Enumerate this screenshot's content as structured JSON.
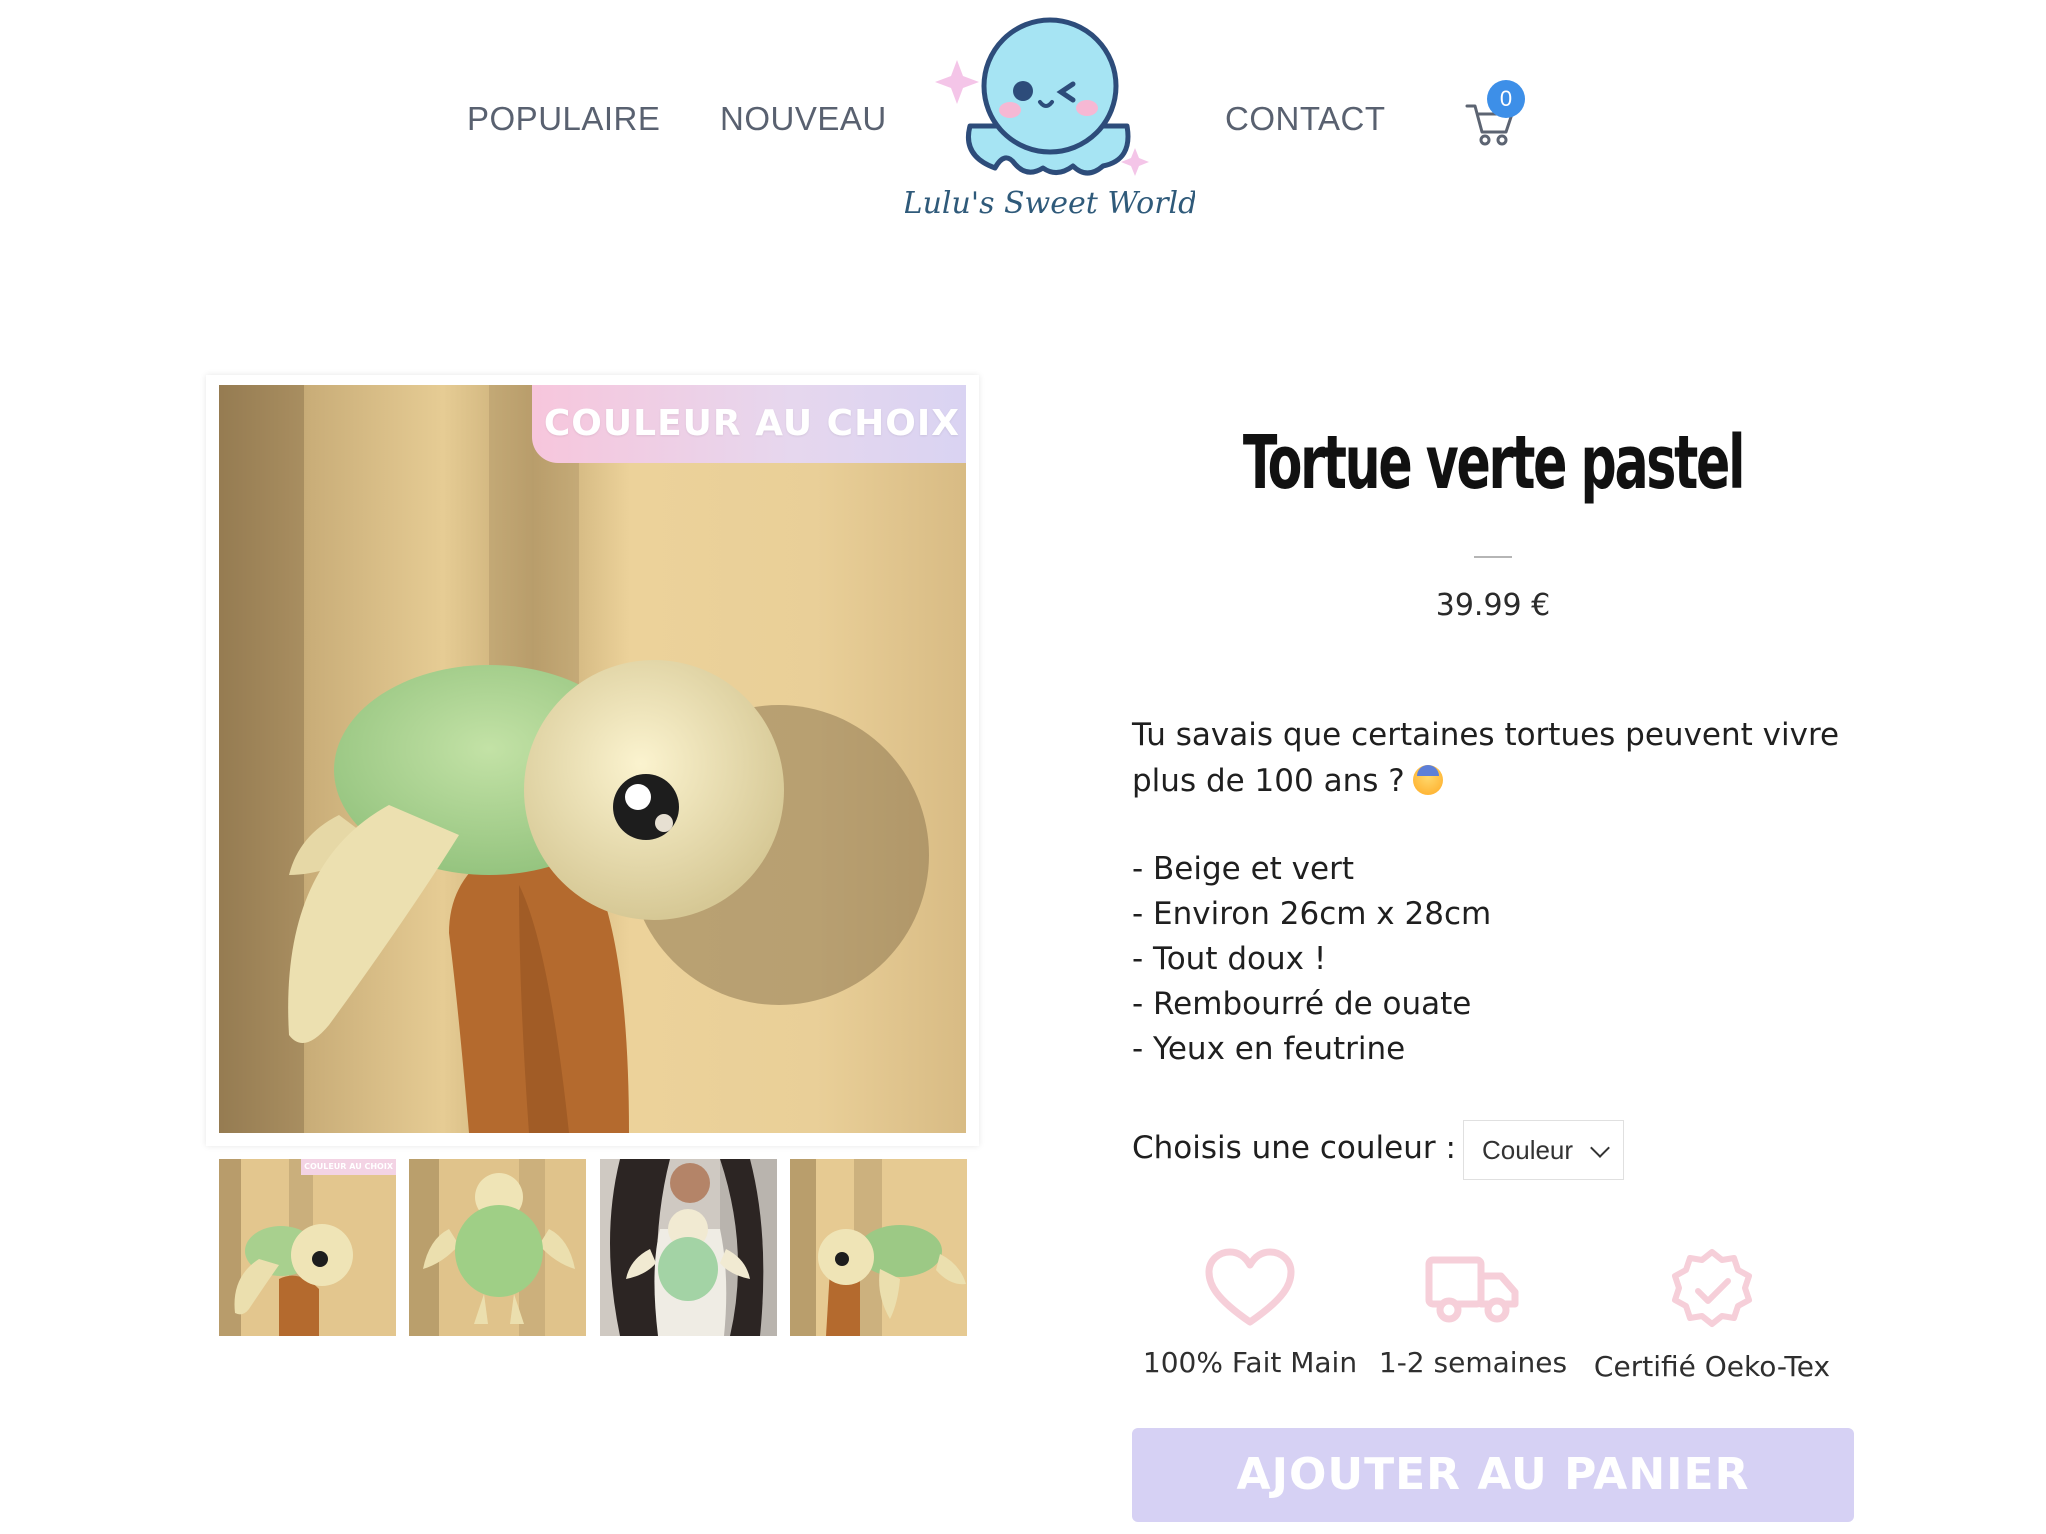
{
  "header": {
    "nav": [
      "POPULAIRE",
      "NOUVEAU",
      "CONTACT"
    ],
    "logo_text": "Lulu's Sweet World",
    "cart_count": "0",
    "icons": {
      "logo": "octopus-logo",
      "cart": "cart-icon"
    }
  },
  "gallery": {
    "main_badge": "COULEUR AU CHOIX",
    "thumbnails": 4
  },
  "product": {
    "title": "Tortue verte pastel",
    "price": "39.99 €",
    "intro_line1": "Tu savais que certaines tortues peuvent vivre",
    "intro_line2": "plus de 100 ans ?",
    "bullets": [
      "- Beige et vert",
      "- Environ 26cm x 28cm",
      "- Tout doux !",
      "- Rembourré de ouate",
      "- Yeux en feutrine"
    ],
    "color_label": "Choisis une couleur :",
    "color_select_value": "Couleur"
  },
  "features": [
    {
      "icon": "heart-icon",
      "label": "100% Fait Main"
    },
    {
      "icon": "truck-icon",
      "label": "1-2 semaines"
    },
    {
      "icon": "certified-badge-icon",
      "label": "Certifié Oeko-Tex"
    }
  ],
  "cta": {
    "label": "AJOUTER AU PANIER"
  },
  "colors": {
    "nav_text": "#596170",
    "cart_badge": "#3d8fe8",
    "icon_pink": "#f6cfd9",
    "cta_bg": "#d6d1f4"
  }
}
